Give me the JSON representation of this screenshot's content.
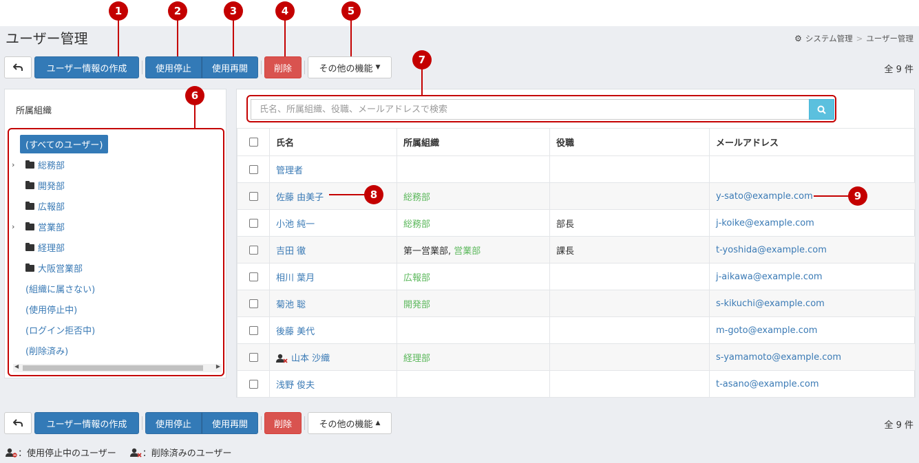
{
  "page": {
    "title": "ユーザー管理",
    "breadcrumb": [
      "システム管理",
      "ユーザー管理"
    ]
  },
  "toolbar": {
    "back_icon": "back-arrow-icon",
    "create": "ユーザー情報の作成",
    "disable": "使用停止",
    "enable": "使用再開",
    "delete": "削除",
    "more": "その他の機能",
    "count": "全 9 件"
  },
  "callouts": [
    "1",
    "2",
    "3",
    "4",
    "5",
    "6",
    "7",
    "8",
    "9"
  ],
  "sidebar": {
    "title": "所属組織",
    "items": [
      {
        "label": "(すべてのユーザー)",
        "selected": true
      },
      {
        "label": "総務部",
        "folder": true,
        "expandable": true
      },
      {
        "label": "開発部",
        "folder": true
      },
      {
        "label": "広報部",
        "folder": true
      },
      {
        "label": "営業部",
        "folder": true,
        "expandable": true
      },
      {
        "label": "経理部",
        "folder": true
      },
      {
        "label": "大阪営業部",
        "folder": true
      },
      {
        "label": "(組織に属さない)"
      },
      {
        "label": "(使用停止中)"
      },
      {
        "label": "(ログイン拒否中)"
      },
      {
        "label": "(削除済み)"
      }
    ]
  },
  "search": {
    "placeholder": "氏名、所属組織、役職、メールアドレスで検索"
  },
  "table": {
    "headers": [
      "氏名",
      "所属組織",
      "役職",
      "メールアドレス"
    ],
    "rows": [
      {
        "name": "管理者",
        "org": "",
        "org_prefix": "",
        "title": "",
        "email": ""
      },
      {
        "name": "佐藤 由美子",
        "org": "総務部",
        "org_prefix": "",
        "title": "",
        "email": "y-sato@example.com"
      },
      {
        "name": "小池 純一",
        "org": "総務部",
        "org_prefix": "",
        "title": "部長",
        "email": "j-koike@example.com"
      },
      {
        "name": "吉田 徹",
        "org": "営業部",
        "org_prefix": "第一営業部, ",
        "title": "課長",
        "email": "t-yoshida@example.com"
      },
      {
        "name": "相川 葉月",
        "org": "広報部",
        "org_prefix": "",
        "title": "",
        "email": "j-aikawa@example.com"
      },
      {
        "name": "菊池 聡",
        "org": "開発部",
        "org_prefix": "",
        "title": "",
        "email": "s-kikuchi@example.com"
      },
      {
        "name": "後藤 美代",
        "org": "",
        "org_prefix": "",
        "title": "",
        "email": "m-goto@example.com"
      },
      {
        "name": "山本 沙織",
        "org": "経理部",
        "org_prefix": "",
        "title": "",
        "email": "s-yamamoto@example.com",
        "deleted": true
      },
      {
        "name": "浅野 俊夫",
        "org": "",
        "org_prefix": "",
        "title": "",
        "email": "t-asano@example.com"
      }
    ]
  },
  "legend": {
    "disabled": "：使用停止中のユーザー",
    "deleted": "：削除済みのユーザー"
  },
  "colors": {
    "primary": "#337ab7",
    "danger": "#d9534f",
    "info": "#5bc0de",
    "callout": "#c40000",
    "org_green": "#5cb85c",
    "link": "#3a7ab5"
  }
}
